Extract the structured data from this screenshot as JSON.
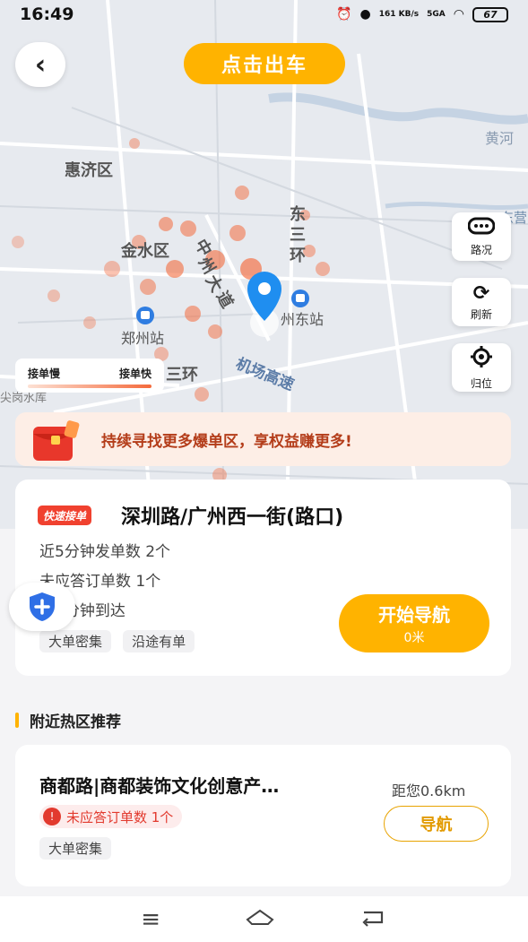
{
  "status_bar": {
    "time": "16:49",
    "net_speed": "161 KB/s",
    "signal": "5GA",
    "battery": "67"
  },
  "header": {
    "depart_button": "点击出车"
  },
  "map": {
    "labels": {
      "huiji": "惠济区",
      "jinshui": "金水区",
      "zhengzhou_station": "郑州站",
      "east_station": "州东站",
      "huanghe": "黄河",
      "dong_san_huan_1": "东",
      "dong_san_huan_2": "三",
      "dong_san_huan_3": "环",
      "zhongzhou_1": "中",
      "zhongzhou_2": "州",
      "zhongzhou_3": "大",
      "zhongzhou_4": "道",
      "airport_road": "机场高速",
      "san_huan": "三环",
      "reservoir": "尖岗水库",
      "east_edge": "东营"
    },
    "controls": {
      "traffic": "路况",
      "refresh": "刷新",
      "locate": "归位"
    },
    "legend": {
      "slow": "接单慢",
      "fast": "接单快"
    }
  },
  "promo": {
    "text": "持续寻找更多爆单区，享权益赚更多!"
  },
  "hot_card": {
    "tag": "快速接单",
    "title": "深圳路/广州西一街(路口)",
    "recent_orders": "近5分钟发单数  2个",
    "missed_orders": "未应答订单数  1个",
    "arrival": "约0分钟到达",
    "tags": [
      "大单密集",
      "沿途有单"
    ],
    "nav_button": "开始导航",
    "nav_distance": "0米"
  },
  "nearby": {
    "section_title": "附近热区推荐",
    "item": {
      "title": "商都路|商都装饰文化创意产…",
      "distance": "距您0.6km",
      "missed": "未应答订单数 1个",
      "tag": "大单密集",
      "nav_button": "导航"
    }
  },
  "colors": {
    "accent": "#ffb300",
    "heat": "#f46a3c",
    "alert": "#f0412f",
    "pin": "#1f8ef0"
  }
}
